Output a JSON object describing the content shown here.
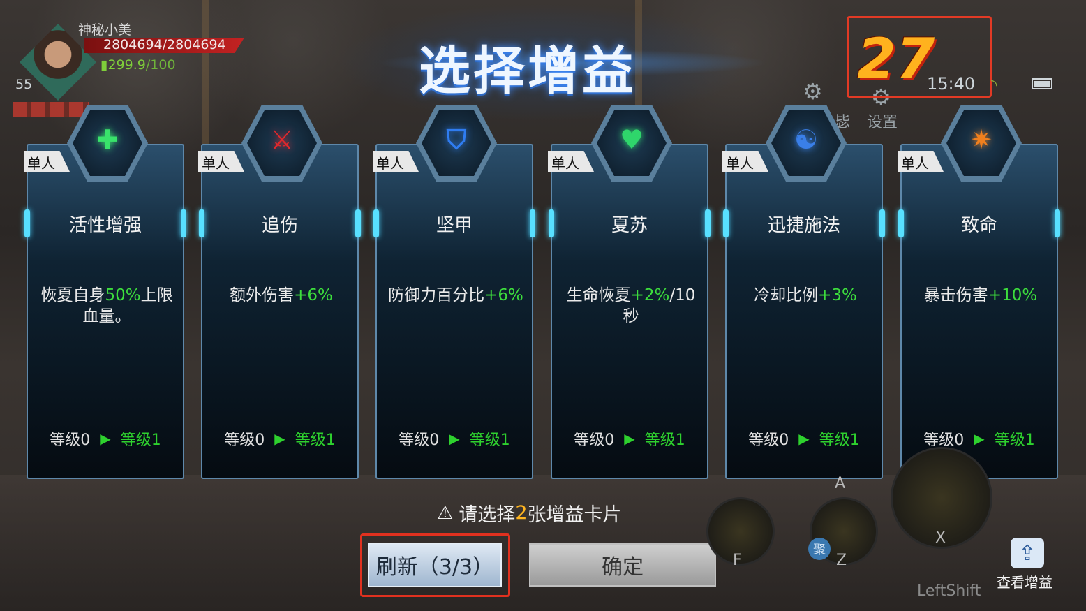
{
  "player": {
    "name": "神秘小美",
    "hp": "2804694/2804694",
    "energy_current": "299.9",
    "energy_max": "/100",
    "level": "55"
  },
  "title": "选择增益",
  "countdown": "27",
  "status": {
    "clock": "15:40",
    "settings_label": "设置",
    "partial_label": "毖"
  },
  "cards": [
    {
      "badge": "单人",
      "name": "活性增强",
      "desc_pre": "恢夏自身",
      "desc_hl": "50%",
      "desc_post": "上限血量。",
      "level_from": "等级0",
      "level_to": "等级1",
      "icon": "gear-glow-icon",
      "icon_color": "#39e36b"
    },
    {
      "badge": "单人",
      "name": "追伤",
      "desc_pre": "额外伤害",
      "desc_hl": "+6%",
      "desc_post": "",
      "level_from": "等级0",
      "level_to": "等级1",
      "icon": "slash-icon",
      "icon_color": "#e0282c"
    },
    {
      "badge": "单人",
      "name": "坚甲",
      "desc_pre": "防御力百分比",
      "desc_hl": "+6%",
      "desc_post": "",
      "level_from": "等级0",
      "level_to": "等级1",
      "icon": "shield-icon",
      "icon_color": "#2f7cf0"
    },
    {
      "badge": "单人",
      "name": "夏苏",
      "desc_pre": "生命恢夏",
      "desc_hl": "+2%",
      "desc_post": "/10秒",
      "level_from": "等级0",
      "level_to": "等级1",
      "icon": "heart-plus-icon",
      "icon_color": "#2fd66b"
    },
    {
      "badge": "单人",
      "name": "迅捷施法",
      "desc_pre": "冷却比例",
      "desc_hl": "+3%",
      "desc_post": "",
      "level_from": "等级0",
      "level_to": "等级1",
      "icon": "mage-icon",
      "icon_color": "#3a7fe8"
    },
    {
      "badge": "单人",
      "name": "致命",
      "desc_pre": "暴击伤害",
      "desc_hl": "+10%",
      "desc_post": "",
      "level_from": "等级0",
      "level_to": "等级1",
      "icon": "critical-icon",
      "icon_color": "#f0801e"
    }
  ],
  "prompt": {
    "pre": "请选择",
    "num": "2",
    "post": "张增益卡片"
  },
  "buttons": {
    "refresh": "刷新（3/3）",
    "confirm": "确定"
  },
  "controls": {
    "view_buff": "查看增益",
    "key_f": "F",
    "key_z": "Z",
    "key_x": "X",
    "key_a": "A",
    "key_shift": "LeftShift",
    "ju": "聚"
  },
  "colors": {
    "highlight": "#3ddd3d",
    "accent_orange": "#ffb21e",
    "warning_red": "#e23a25"
  }
}
